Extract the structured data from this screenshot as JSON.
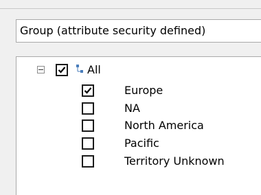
{
  "dimension_select": {
    "value": "Group (attribute security defined)"
  },
  "tree": {
    "root": {
      "label": "All",
      "state": "checked",
      "expanded": true,
      "icon": "hierarchy-icon",
      "expander_icon": "collapse-minus-icon"
    },
    "items": [
      {
        "label": "Europe",
        "checked": true
      },
      {
        "label": "NA",
        "checked": false
      },
      {
        "label": "North America",
        "checked": false
      },
      {
        "label": "Pacific",
        "checked": false
      },
      {
        "label": "Territory Unknown",
        "checked": false
      }
    ]
  },
  "colors": {
    "window_bg": "#f0f0f0",
    "panel_bg": "#ffffff",
    "border": "#a9a9a9",
    "hierarchy_icon": "#4a7ebb"
  }
}
